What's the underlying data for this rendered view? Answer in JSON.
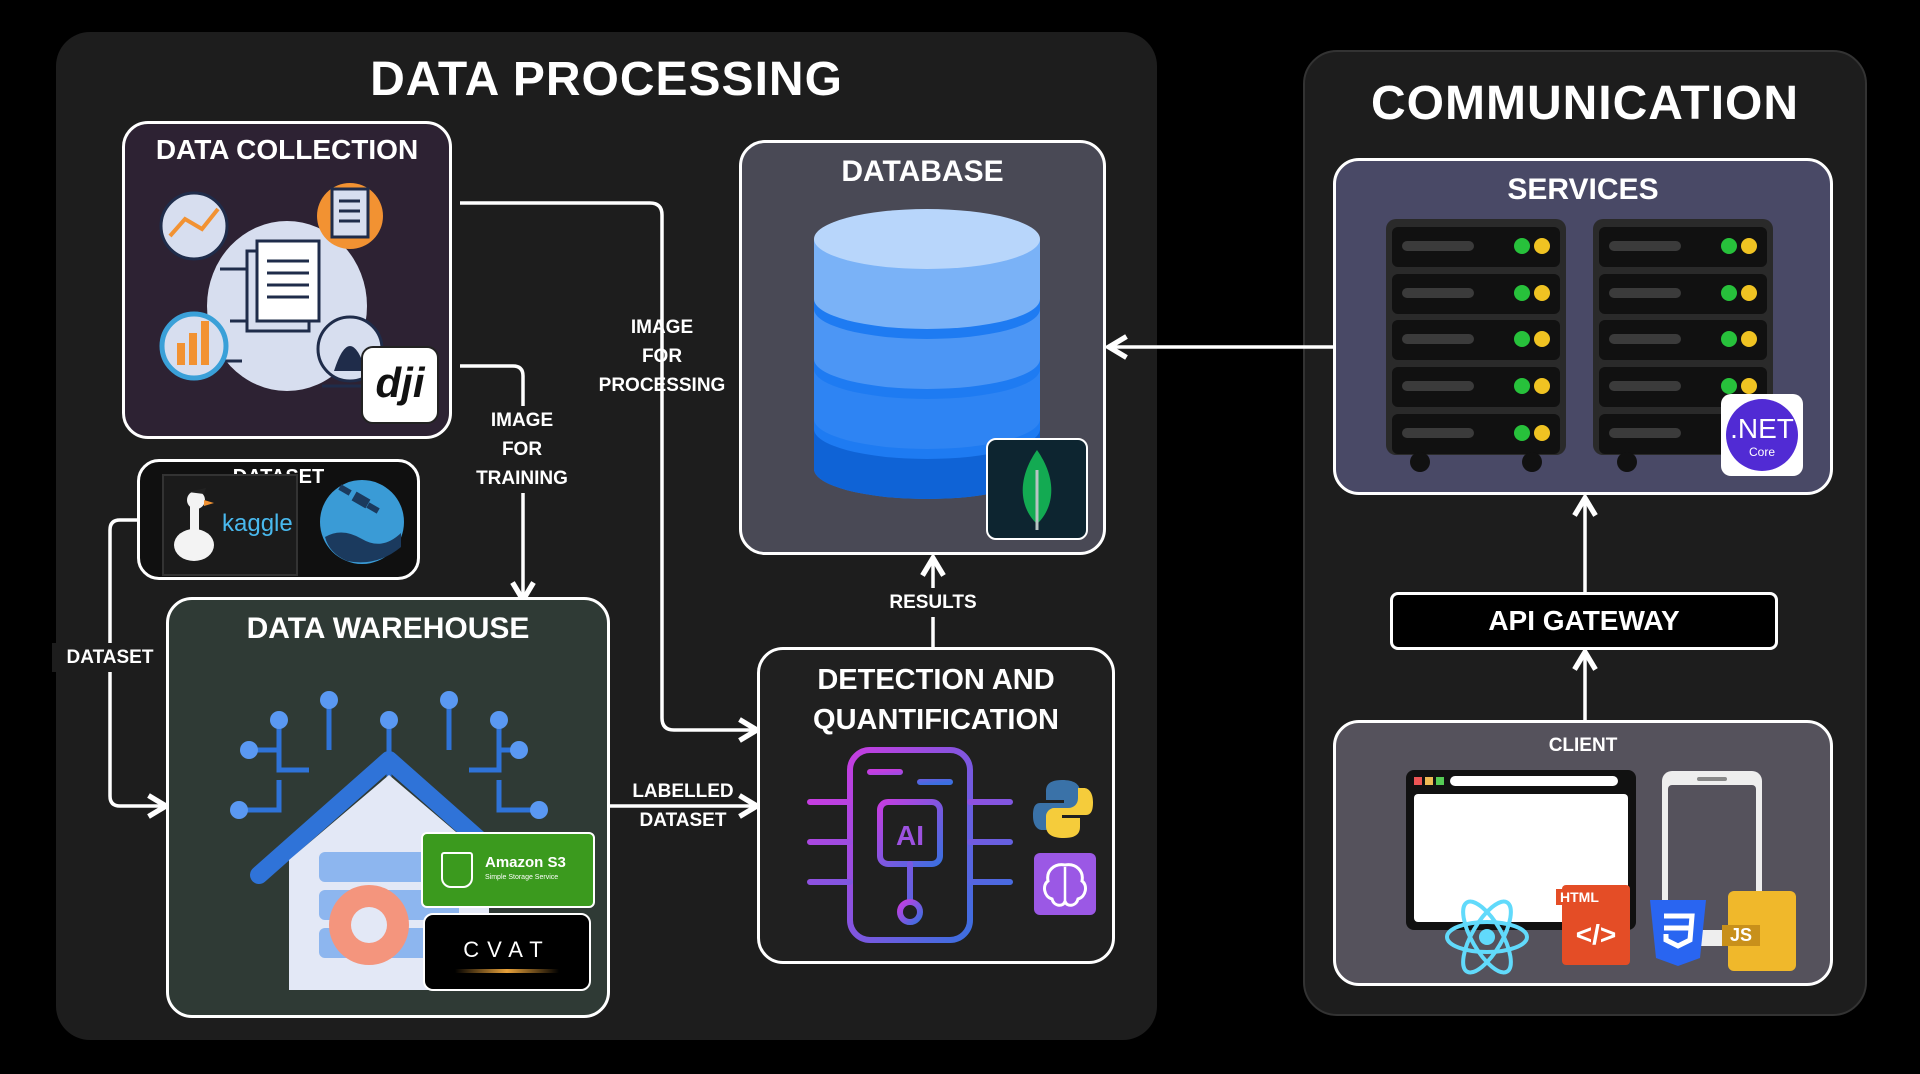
{
  "data_processing": {
    "title": "DATA PROCESSING",
    "data_collection": {
      "title": "DATA COLLECTION",
      "logo_text": "dji"
    },
    "dataset_box": {
      "title": "DATASET",
      "logo_text": "kaggle"
    },
    "data_warehouse": {
      "title": "DATA WAREHOUSE",
      "s3_text": "Amazon S3",
      "s3_sub": "Simple Storage Service",
      "cvat_text": "CVAT"
    },
    "database": {
      "title": "DATABASE"
    },
    "detection": {
      "title_line1": "DETECTION AND",
      "title_line2": "QUANTIFICATION",
      "chip_text": "AI"
    }
  },
  "communication": {
    "title": "COMMUNICATION",
    "services": {
      "title": "SERVICES",
      "dotnet_text": ".NET",
      "dotnet_sub": "Core"
    },
    "api_gateway": {
      "title": "API GATEWAY"
    },
    "client": {
      "title": "CLIENT",
      "html_badge": "HTML",
      "js_badge": "JS"
    }
  },
  "edges": {
    "image_for_processing": [
      "IMAGE",
      "FOR",
      "PROCESSING"
    ],
    "image_for_training": [
      "IMAGE",
      "FOR",
      "TRAINING"
    ],
    "dataset": "DATASET",
    "labelled_dataset": [
      "LABELLED",
      "DATASET"
    ],
    "results": "RESULTS"
  },
  "colors": {
    "panel_bg": "#1d1d1d",
    "data_collection_bg": "#2d2233",
    "database_bg": "#494955",
    "warehouse_bg": "#2f3a35",
    "services_bg": "#494966",
    "client_bg": "#55525c",
    "accent_blue": "#1e7bf2",
    "mongo_green": "#13aa52",
    "dotnet_purple": "#512bd4"
  },
  "icons": [
    "dji-logo",
    "kaggle-logo",
    "satellite-globe-icon",
    "warehouse-house-icon",
    "amazon-s3-logo",
    "cvat-logo",
    "database-cylinder-icon",
    "mongodb-leaf-icon",
    "ai-chip-icon",
    "python-logo",
    "neural-brain-icon",
    "server-rack-icon",
    "dotnet-core-logo",
    "browser-window-icon",
    "phone-icon",
    "react-logo",
    "html5-logo",
    "css3-logo",
    "js-logo"
  ]
}
